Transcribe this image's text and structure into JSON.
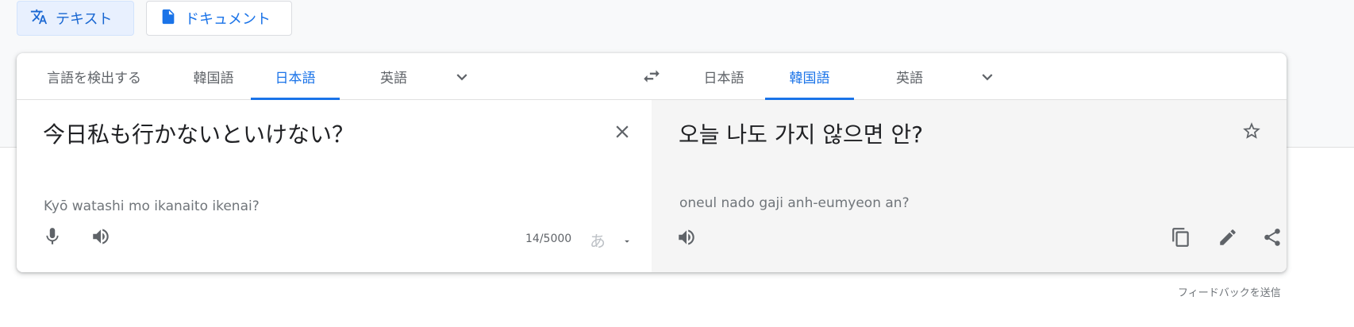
{
  "modes": [
    {
      "label": "テキスト",
      "icon": "translate-icon",
      "active": true
    },
    {
      "label": "ドキュメント",
      "icon": "document-icon",
      "active": false
    }
  ],
  "source_langs": {
    "tabs": [
      "言語を検出する",
      "韓国語",
      "日本語",
      "英語"
    ],
    "active_index": 2
  },
  "target_langs": {
    "tabs": [
      "日本語",
      "韓国語",
      "英語"
    ],
    "active_index": 1
  },
  "source": {
    "text": "今日私も行かないといけない？",
    "romanization": "Kyō watashi mo ikanaito ikenai?",
    "char_count": "14/5000",
    "ime_label": "あ"
  },
  "target": {
    "text": "오늘 나도 가지 않으면 안?",
    "romanization": "oneul nado gaji anh-eumyeon an?"
  },
  "footer": {
    "feedback": "フィードバックを送信"
  },
  "colors": {
    "accent": "#1a73e8",
    "target_bg": "#f5f5f5",
    "page_bg": "#f8f9fa"
  }
}
